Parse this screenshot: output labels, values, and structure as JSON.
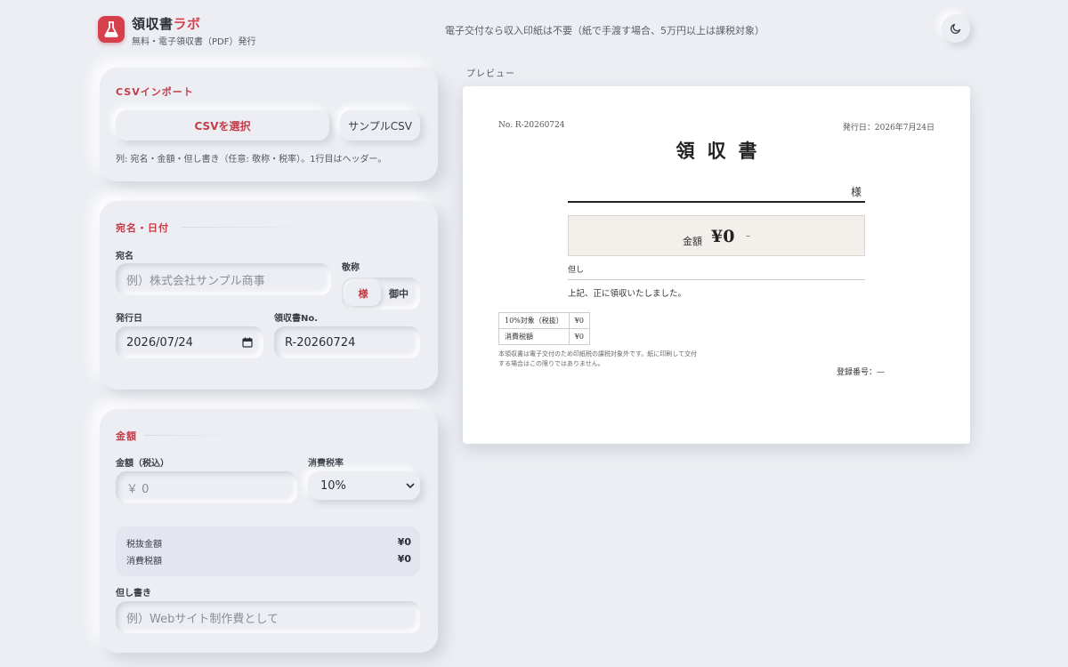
{
  "header": {
    "app_name_main": "領収書",
    "app_name_accent": "ラボ",
    "subtitle": "無料・電子領収書（PDF）発行",
    "notice": "電子交付なら収入印紙は不要（紙で手渡す場合、5万円以上は課税対象）",
    "theme_toggle_icon": "moon-icon",
    "logo_icon": "flask-icon"
  },
  "csv_import": {
    "title": "CSVインポート",
    "select_button": "CSVを選択",
    "sample_button": "サンプルCSV",
    "hint": "列: 宛名・金額・但し書き（任意: 敬称・税率）。1行目はヘッダー。"
  },
  "recipient": {
    "title": "宛名・日付",
    "name_label": "宛名",
    "name_placeholder": "例）株式会社サンプル商事",
    "honorific_label": "敬称",
    "honorific_options": [
      "様",
      "御中"
    ],
    "honorific_selected": "様",
    "date_label": "発行日",
    "date_value": "2026/07/24",
    "number_label": "領収書No.",
    "number_value": "R-20260724"
  },
  "amount": {
    "title": "金額",
    "amount_label": "金額（税込）",
    "amount_placeholder": "￥ 0",
    "tax_rate_label": "消費税率",
    "tax_rate_selected": "10%",
    "excl_label": "税抜金額",
    "excl_value": "¥0",
    "tax_label": "消費税額",
    "tax_value": "¥0",
    "memo_label": "但し書き",
    "memo_placeholder": "例）Webサイト制作費として"
  },
  "preview": {
    "label": "プレビュー",
    "receipt_no": "No. R-20260724",
    "issue_date": "発行日：2026年7月24日",
    "doc_title": "領収書",
    "honorific": "様",
    "amount_label": "金額",
    "amount_value": "¥0",
    "amount_suffix": "–",
    "tadashi": "但し",
    "received_text": "上記、正に領収いたしました。",
    "tax_table": [
      {
        "label": "10%対象（税抜）",
        "value": "¥0"
      },
      {
        "label": "消費税額",
        "value": "¥0"
      }
    ],
    "note": "本領収書は電子交付のため印紙税の課税対象外です。紙に印刷して交付する場合はこの限りではありません。",
    "registration": "登録番号：—"
  },
  "colors": {
    "accent": "#d6404d",
    "background": "#eceef3"
  }
}
